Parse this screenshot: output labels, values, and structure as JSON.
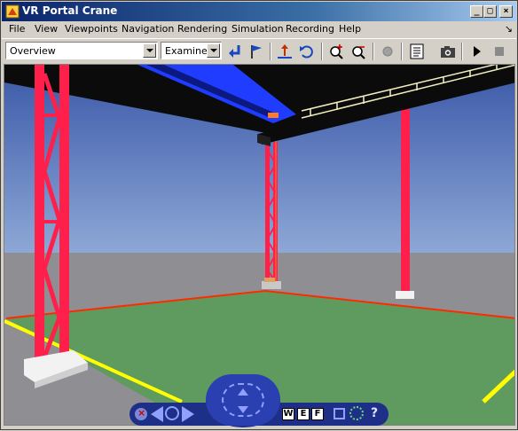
{
  "window": {
    "title": "VR Portal Crane",
    "controls": [
      "minimize",
      "maximize",
      "close"
    ]
  },
  "menu": {
    "items": [
      "File",
      "View",
      "Viewpoints",
      "Navigation",
      "Rendering",
      "Simulation",
      "Recording",
      "Help"
    ]
  },
  "toolbar": {
    "viewpoint_value": "Overview",
    "navmode_value": "Examine",
    "tools": [
      "return-to-viewpoint-icon",
      "create-viewpoint-flag-icon",
      "straighten-up-icon",
      "undo-move-icon",
      "zoom-in-icon",
      "zoom-out-icon",
      "headlight-icon",
      "view-settings-icon",
      "snapshot-camera-icon",
      "start-simulation-icon",
      "stop-simulation-icon"
    ]
  },
  "navpanel": {
    "w_label": "W",
    "e_label": "E",
    "f_label": "F",
    "help_label": "?"
  },
  "colors": {
    "sky_top": "#3a57a8",
    "sky_bottom": "#8ea9d6",
    "ground": "#8f8f93",
    "floor": "#5f9a5f",
    "column": "#ff1f4b",
    "beam": "#0b0b0b",
    "trolley": "#1f3cff",
    "boundary": "#ff2a00",
    "road": "#ffff00",
    "titlebar": "#0a246a",
    "nav_panel": "#1e2f88"
  }
}
